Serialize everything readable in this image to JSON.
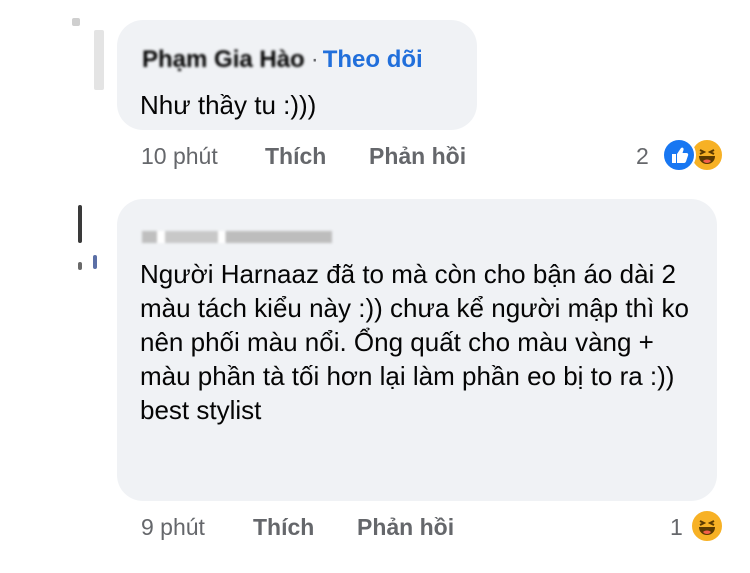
{
  "comments": [
    {
      "author": "Phạm Gia Hào",
      "follow_label": "Theo dõi",
      "text": "Như thầy tu :)))",
      "time": "10 phút",
      "like_label": "Thích",
      "reply_label": "Phản hồi",
      "reaction_count": "2",
      "reactions": [
        "like-icon",
        "haha-icon"
      ]
    },
    {
      "author": "",
      "text": "Người Harnaaz đã to mà còn cho bận áo dài 2 màu tách kiểu này :)) chưa kể người mập thì ko nên phối màu nổi. Ổng quất cho màu vàng + màu phần tà tối hơn lại làm phần eo bị to ra :)) best stylist",
      "time": "9 phút",
      "like_label": "Thích",
      "reply_label": "Phản hồi",
      "reaction_count": "1",
      "reactions": [
        "haha-icon"
      ]
    }
  ],
  "colors": {
    "bubble": "#f0f2f5",
    "follow": "#216fdb",
    "meta": "#65676b",
    "like": "#1877f2",
    "haha": "#f7b125"
  }
}
